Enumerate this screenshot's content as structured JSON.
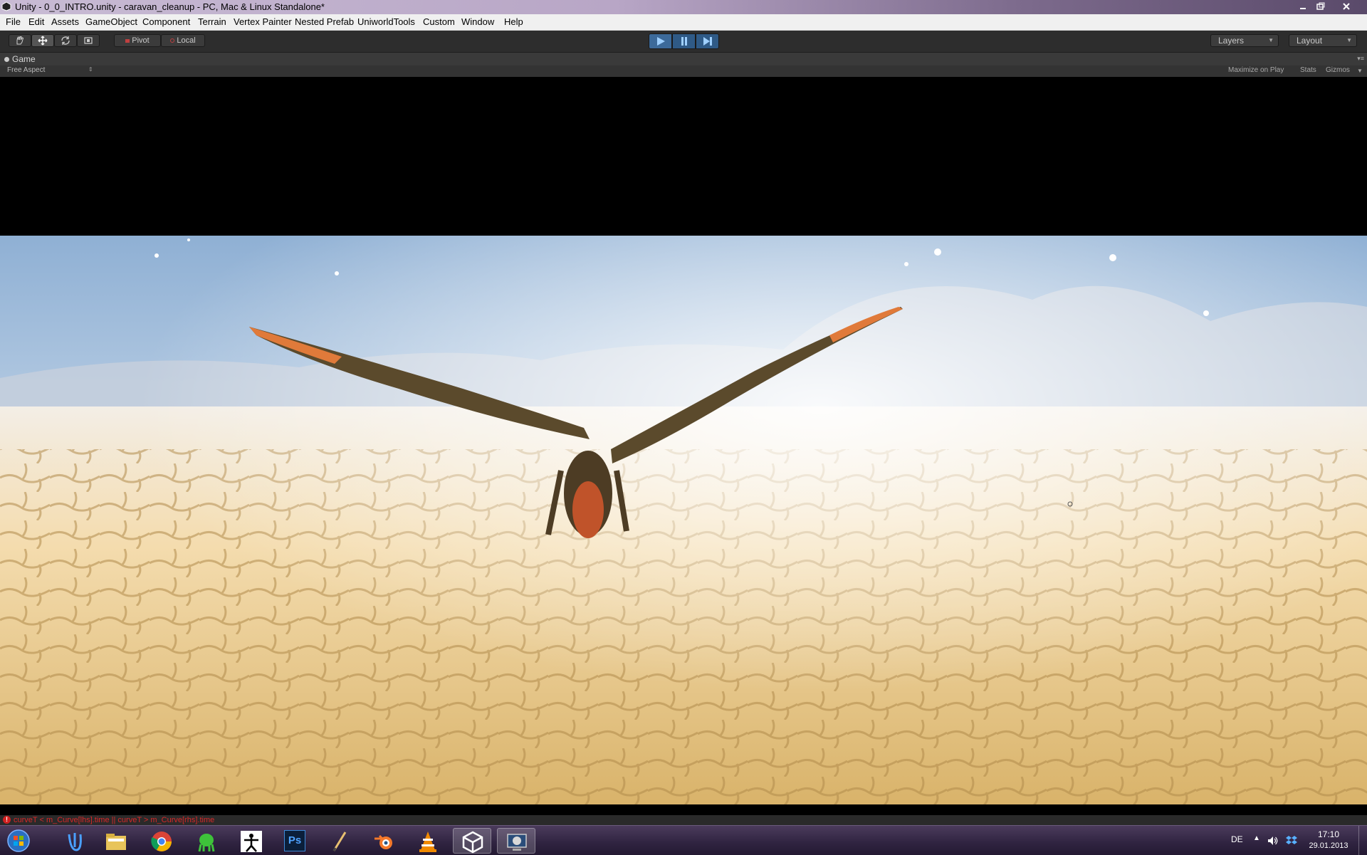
{
  "window": {
    "title": "Unity - 0_0_INTRO.unity - caravan_cleanup - PC, Mac & Linux Standalone*",
    "minimize_icon": "minimize-icon",
    "maximize_icon": "restore-icon",
    "close_icon": "close-icon"
  },
  "menu": {
    "items": [
      "File",
      "Edit",
      "Assets",
      "GameObject",
      "Component",
      "Terrain",
      "Vertex Painter",
      "Nested Prefab",
      "UniworldTools",
      "Custom",
      "Window",
      "Help"
    ]
  },
  "toolbar": {
    "tools": [
      "hand-icon",
      "move-icon",
      "rotate-icon",
      "scale-icon"
    ],
    "pivot_label": "Pivot",
    "local_label": "Local",
    "play_icon": "play-icon",
    "pause_icon": "pause-icon",
    "step_icon": "step-icon",
    "layers_label": "Layers",
    "layout_label": "Layout"
  },
  "game_view": {
    "tab_label": "Game",
    "aspect_label": "Free Aspect",
    "maximize_label": "Maximize on Play",
    "stats_label": "Stats",
    "gizmos_label": "Gizmos"
  },
  "console": {
    "error_message": "curveT < m_Curve[lhs].time || curveT > m_Curve[rhs].time"
  },
  "taskbar": {
    "apps": [
      "start-orb-icon",
      "wacom-icon",
      "file-explorer-icon",
      "chrome-icon",
      "alien-app-icon",
      "zbrush-icon",
      "photoshop-icon",
      "pen-tool-icon",
      "blender-icon",
      "vlc-icon",
      "unity-icon",
      "remote-desktop-icon"
    ],
    "photoshop_label": "Ps",
    "language": "DE",
    "time": "17:10",
    "date": "29.01.2013"
  },
  "colors": {
    "toolbar_bg": "#2d2d2d",
    "play_active": "#3c6a9a",
    "error_text": "#d82828"
  }
}
